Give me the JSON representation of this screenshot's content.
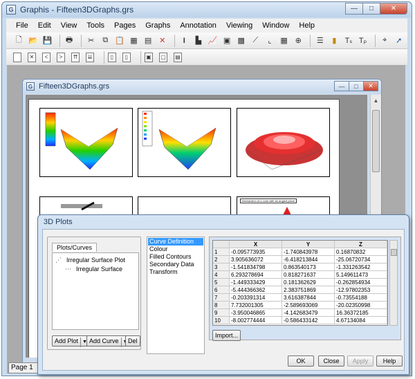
{
  "app": {
    "title": "Graphis - Fifteen3DGraphs.grs",
    "icon_letter": "G"
  },
  "window_buttons": {
    "minimize": "—",
    "maximize": "□",
    "close": "✕"
  },
  "menu": [
    "File",
    "Edit",
    "View",
    "Tools",
    "Pages",
    "Graphs",
    "Annotation",
    "Viewing",
    "Window",
    "Help"
  ],
  "toolbar1": {
    "icons": [
      "new-file-icon",
      "open-folder-icon",
      "save-icon",
      "print-icon",
      "cut-icon",
      "copy-icon",
      "paste-icon",
      "graph-copy-icon",
      "graph-paste-icon",
      "delete-icon",
      "text-tool-icon",
      "highlight-icon",
      "graph-wizard-icon",
      "graph-2d-icon",
      "graph-3d-icon",
      "line-graph-icon",
      "axes-icon",
      "table-icon",
      "globe-icon",
      "list-icon",
      "colour-icon",
      "font-size-icon",
      "font-style-icon",
      "pointer-icon",
      "arrow-icon"
    ],
    "glyphs": [
      "🗋",
      "📂",
      "💾",
      "🖶",
      "✂",
      "⧉",
      "📋",
      "▦",
      "▤",
      "✕",
      "I",
      "▙",
      "📈",
      "▣",
      "▩",
      "⟋",
      "⌞",
      "▦",
      "⊕",
      "☰",
      "▮",
      "Tₛ",
      "Tₚ",
      "⌖",
      "➚"
    ]
  },
  "toolbar2": {
    "icons": [
      "page-icon",
      "page-x-icon",
      "page-prev-icon",
      "page-next-icon",
      "page-up-icon",
      "page-down-icon",
      "layout-single-icon",
      "layout-double-icon",
      "layout-grid-icon",
      "layout-full-icon",
      "layout-list-icon"
    ],
    "glyphs": [
      "",
      "✕",
      "<",
      ">",
      "⇈",
      "⇊",
      "▯",
      "▯",
      "▣",
      "▢",
      "▤"
    ]
  },
  "child": {
    "title": "Fifteen3DGraphs.grs",
    "graph6_caption": "Intersection of a cone with an angled plane"
  },
  "status": {
    "page": "Page 1 of 3"
  },
  "dialog": {
    "title": "3D Plots",
    "tab_label": "Plots/Curves",
    "tree": [
      {
        "label": "Irregular Surface Plot",
        "level": 0
      },
      {
        "label": "Irregular Surface",
        "level": 1
      }
    ],
    "add_plot": "Add Plot",
    "add_curve": "Add Curve",
    "del": "Del",
    "options": [
      "Curve Definition",
      "Colour",
      "Filled Contours",
      "Secondary Data",
      "Transform"
    ],
    "selected_option": 0,
    "columns": [
      "",
      "X",
      "Y",
      "Z"
    ],
    "rows": [
      [
        "1",
        "-0.095773935",
        "-1.740843978",
        "0.16870832"
      ],
      [
        "2",
        "3.905636072",
        "-6.418213844",
        "-25.06720734"
      ],
      [
        "3",
        "-1.541834798",
        "0.863540173",
        "-1.331263542"
      ],
      [
        "4",
        "6.293278694",
        "0.818271637",
        "5.149611473"
      ],
      [
        "5",
        "-1.449333429",
        "0.181362629",
        "-0.262854934"
      ],
      [
        "6",
        "-5.444366362",
        "2.383751869",
        "-12.97802353"
      ],
      [
        "7",
        "-0.203391314",
        "3.616387844",
        "-0.73554188"
      ],
      [
        "8",
        "7.732001305",
        "-2.589693069",
        "-20.02350998"
      ],
      [
        "9",
        "-3.950046865",
        "-4.142683479",
        "16.36372185"
      ],
      [
        "10",
        "-8.002774444",
        "-0.586433142",
        "4.67134084"
      ]
    ],
    "import": "Import...",
    "ok": "OK",
    "close": "Close",
    "apply": "Apply",
    "help": "Help"
  }
}
